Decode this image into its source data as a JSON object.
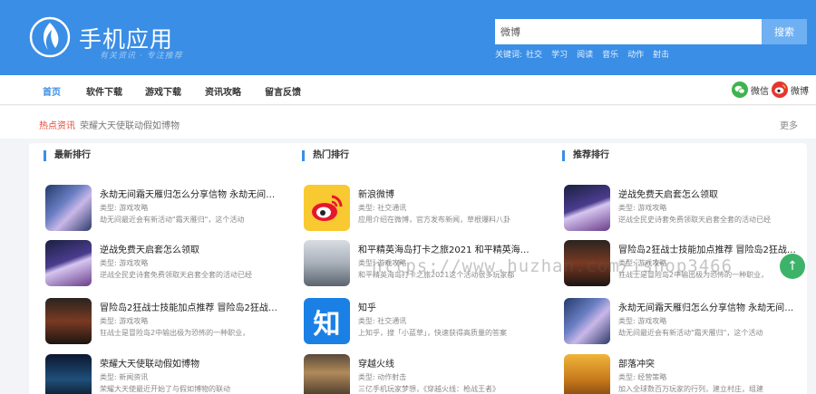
{
  "header": {
    "title": "手机应用",
    "slogan": "有关资讯 · 专注推荐",
    "search_value": "微博",
    "search_button": "搜索",
    "keywords_label": "关键词:",
    "keywords": [
      "社交",
      "学习",
      "阅读",
      "音乐",
      "动作",
      "射击"
    ]
  },
  "nav": {
    "items": [
      "首页",
      "软件下载",
      "游戏下载",
      "资讯攻略",
      "留言反馈"
    ],
    "active": "首页",
    "wechat": "微信",
    "weibo": "微博"
  },
  "ticker": {
    "label": "热点资讯",
    "text": "荣耀大天使联动假如博物",
    "more": "更多"
  },
  "columns": [
    {
      "title": "最新排行",
      "items": [
        {
          "title": "永劫无间霜天雁归怎么分享信物 永劫无间霜天雁归分享信物方法",
          "meta": "类型: 游戏攻略",
          "desc": "劫无间最近会有新活动\"霜天雁归\"，这个活动",
          "thumb": "t-game1"
        },
        {
          "title": "逆战免费天启套怎么领取",
          "meta": "类型: 游戏攻略",
          "desc": "逆战全民史诗套免费领取天启套全套的活动已经",
          "thumb": "t-game2"
        },
        {
          "title": "冒险岛2狂战士技能加点推荐 冒险岛2狂战士技能",
          "meta": "类型: 游戏攻略",
          "desc": "狂战士是冒险岛2中输出极为恐怖的一种职业，",
          "thumb": "t-game3"
        },
        {
          "title": "荣耀大天使联动假如博物",
          "meta": "类型: 新闻资讯",
          "desc": "荣耀大天使最近开始了与假如博物的联动",
          "thumb": "t-game4"
        }
      ]
    },
    {
      "title": "热门排行",
      "items": [
        {
          "title": "新浪微博",
          "meta": "类型: 社交通讯",
          "desc": "应用介绍在微博，官方发布新闻，草根爆料八卦",
          "thumb": "t-weibo"
        },
        {
          "title": "和平精英海岛打卡之旅2021 和平精英海岛打卡",
          "meta": "类型: 游戏攻略",
          "desc": "和平精英海岛打卡之旅2021这个活动很多玩家都",
          "thumb": "t-hpjy"
        },
        {
          "title": "知乎",
          "meta": "类型: 社交通讯",
          "desc": "上知乎，搜「小蓝草」，快速获得高质量的答案",
          "thumb": "t-zhihu"
        },
        {
          "title": "穿越火线",
          "meta": "类型: 动作射击",
          "desc": "三亿手机玩家梦想，《穿越火线：枪战王者》",
          "thumb": "t-cf"
        }
      ]
    },
    {
      "title": "推荐排行",
      "items": [
        {
          "title": "逆战免费天启套怎么领取",
          "meta": "类型: 游戏攻略",
          "desc": "逆战全民史诗套免费领取天启套全套的活动已经",
          "thumb": "t-game2"
        },
        {
          "title": "冒险岛2狂战士技能加点推荐 冒险岛2狂战士技能",
          "meta": "类型: 游戏攻略",
          "desc": "狂战士是冒险岛2中输出极为恐怖的一种职业，",
          "thumb": "t-game3"
        },
        {
          "title": "永劫无间霜天雁归怎么分享信物 永劫无间霜天雁归分享信物方法",
          "meta": "类型: 游戏攻略",
          "desc": "劫无间最近会有新活动\"霜天雁归\"，这个活动",
          "thumb": "t-game1"
        },
        {
          "title": "部落冲突",
          "meta": "类型: 经营策略",
          "desc": "加入全球数百万玩家的行列，建立村庄，组建",
          "thumb": "t-coc"
        }
      ]
    }
  ],
  "watermark": "https://www.huzhan.com/ishop3466",
  "zhihu_glyph": "知",
  "up_glyph": "↑"
}
